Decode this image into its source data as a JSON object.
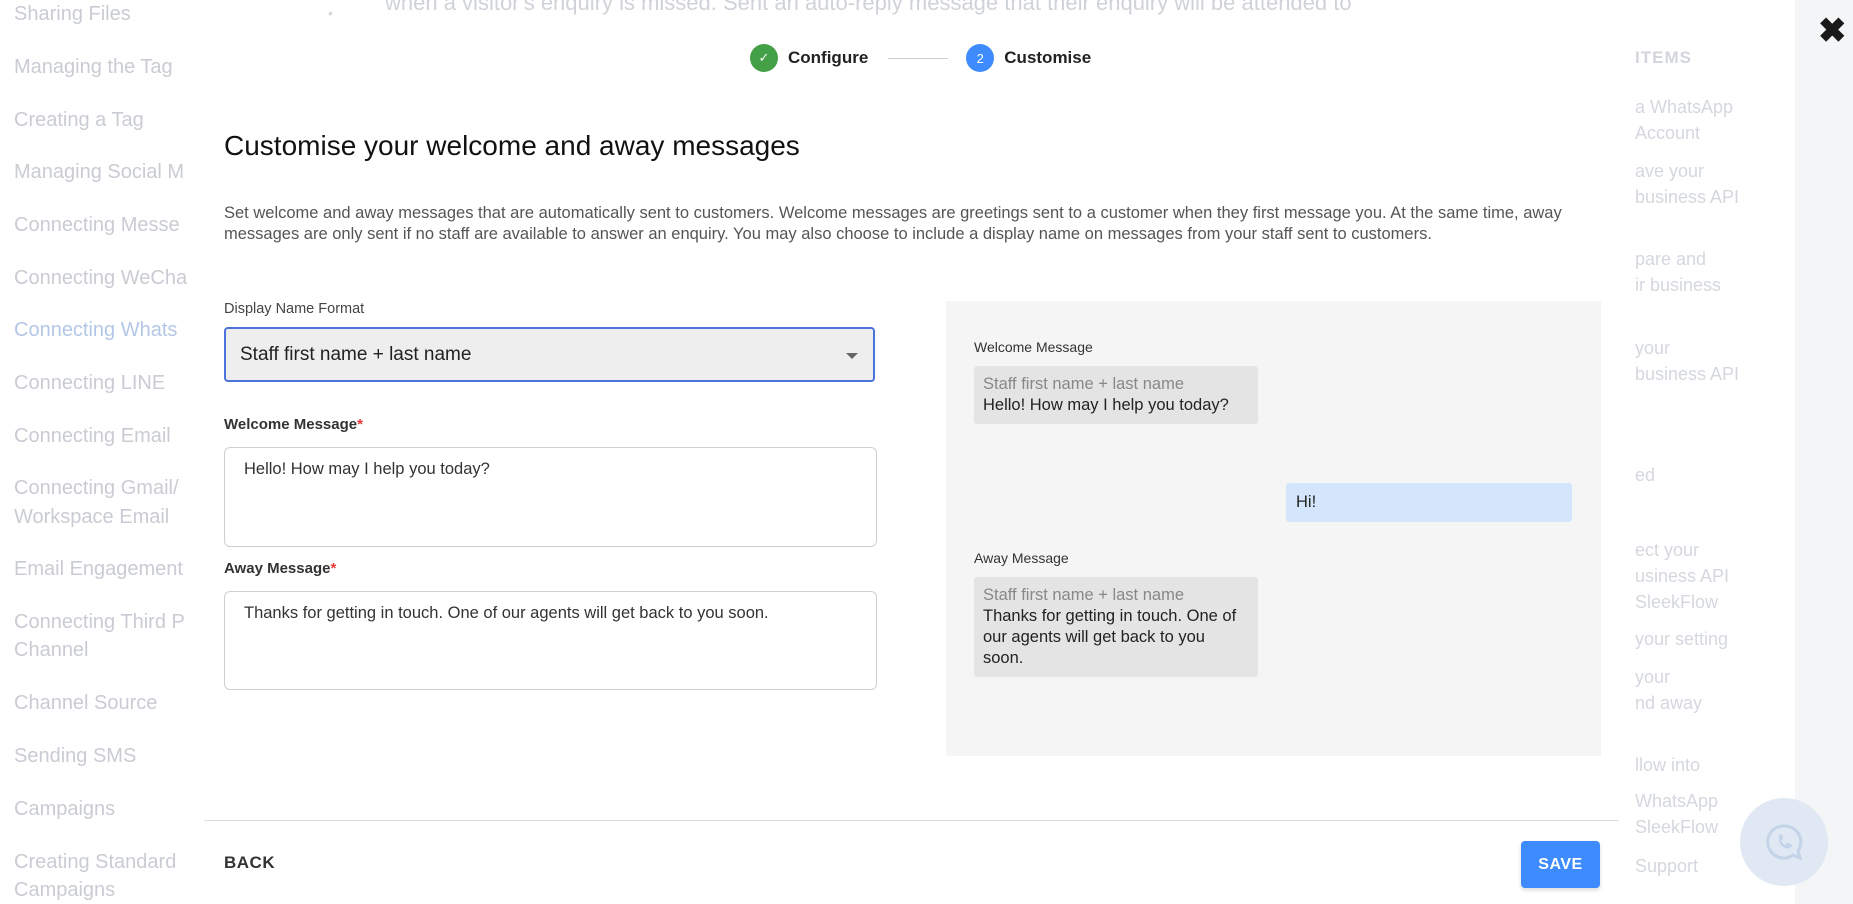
{
  "background": {
    "sidebar_items": [
      "Sharing Files",
      "Managing the Tag",
      "Creating a Tag",
      "Managing Social M",
      "Connecting Messe",
      "Connecting WeCha",
      "Connecting Whats",
      "Connecting LINE",
      "Connecting Email",
      "Connecting Gmail/",
      "Workspace Email",
      "Email Engagement",
      "Connecting Third P",
      "Channel",
      "Channel Source",
      "Sending SMS",
      "Campaigns",
      "Creating Standard",
      "Campaigns"
    ],
    "top_text": "when a visitor's enquiry is missed. Sent an auto-reply message that their enquiry will be attended to",
    "toc_title": "ITEMS",
    "toc_items": [
      "a WhatsApp",
      "Account",
      "ave your",
      "business API",
      "pare and",
      "ir business",
      "your",
      "business API",
      "ed",
      "ect your",
      "usiness API",
      "SleekFlow",
      "your setting",
      "your",
      "nd away",
      "llow into",
      "WhatsApp",
      "SleekFlow",
      "Support"
    ]
  },
  "dialog": {
    "close_label": "✖",
    "steps": [
      {
        "label": "Configure",
        "marker": "✓",
        "color": "#43a047"
      },
      {
        "label": "Customise",
        "marker": "2",
        "color": "#3d8bfd"
      }
    ],
    "title": "Customise your welcome and away messages",
    "description": "Set welcome and away messages that are automatically sent to customers. Welcome messages are greetings sent to a customer when they first message you. At the same time, away messages are only sent if no staff are available to answer an enquiry. You may also choose to include a display name on messages from your staff sent to customers.",
    "display_name_label": "Display Name Format",
    "display_name_value": "Staff first name + last name",
    "welcome_label": "Welcome Message",
    "welcome_value": "Hello! How may I help you today?",
    "away_label": "Away Message",
    "away_value": "Thanks for getting in touch. One of our agents will get back to you soon.",
    "required_marker": "*",
    "preview": {
      "welcome_label": "Welcome Message",
      "welcome_sender": "Staff first name + last name",
      "welcome_text": "Hello! How may I help you today?",
      "customer_text": "Hi!",
      "away_label": "Away Message",
      "away_sender": "Staff first name + last name",
      "away_text": "Thanks for getting in touch. One of our agents will get back to you soon."
    },
    "back_label": "BACK",
    "save_label": "SAVE"
  },
  "colors": {
    "accent": "#3d8bfd",
    "success": "#43a047",
    "required": "#e53935",
    "outgoing_bubble": "#d4e6fb"
  }
}
